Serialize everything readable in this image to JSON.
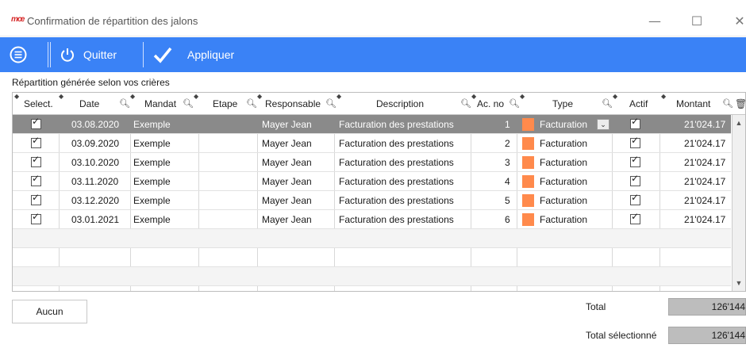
{
  "window": {
    "logo": "mœ",
    "title": "Confirmation de répartition des jalons",
    "minimize": "—",
    "maximize": "☐",
    "close": "✕"
  },
  "toolbar": {
    "quit_label": "Quitter",
    "apply_label": "Appliquer"
  },
  "subtitle": "Répartition générée selon vos crières",
  "table": {
    "columns": [
      "Select.",
      "Date",
      "Mandat",
      "Etape",
      "Responsable",
      "Description",
      "Ac. no",
      "Type",
      "Actif",
      "Montant"
    ],
    "rows": [
      {
        "date": "03.08.2020",
        "mandat": "Exemple",
        "etape": "",
        "responsable": "Mayer Jean",
        "description": "Facturation des prestations",
        "acno": "1",
        "type": "Facturation",
        "montant": "21'024.17",
        "selected": true
      },
      {
        "date": "03.09.2020",
        "mandat": "Exemple",
        "etape": "",
        "responsable": "Mayer Jean",
        "description": "Facturation des prestations",
        "acno": "2",
        "type": "Facturation",
        "montant": "21'024.17",
        "selected": false
      },
      {
        "date": "03.10.2020",
        "mandat": "Exemple",
        "etape": "",
        "responsable": "Mayer Jean",
        "description": "Facturation des prestations",
        "acno": "3",
        "type": "Facturation",
        "montant": "21'024.17",
        "selected": false
      },
      {
        "date": "03.11.2020",
        "mandat": "Exemple",
        "etape": "",
        "responsable": "Mayer Jean",
        "description": "Facturation des prestations",
        "acno": "4",
        "type": "Facturation",
        "montant": "21'024.17",
        "selected": false
      },
      {
        "date": "03.12.2020",
        "mandat": "Exemple",
        "etape": "",
        "responsable": "Mayer Jean",
        "description": "Facturation des prestations",
        "acno": "5",
        "type": "Facturation",
        "montant": "21'024.17",
        "selected": false
      },
      {
        "date": "03.01.2021",
        "mandat": "Exemple",
        "etape": "",
        "responsable": "Mayer Jean",
        "description": "Facturation des prestations",
        "acno": "6",
        "type": "Facturation",
        "montant": "21'024.17",
        "selected": false
      }
    ],
    "type_color": "#ff8a4c",
    "selected_row_color": "#8a8a8a"
  },
  "footer": {
    "none_button": "Aucun",
    "total_label": "Total",
    "total_value": "126'144",
    "total_selected_label": "Total sélectionné",
    "total_selected_value": "126'144"
  },
  "colors": {
    "toolbar": "#3a82f6",
    "logo": "#d62828"
  }
}
